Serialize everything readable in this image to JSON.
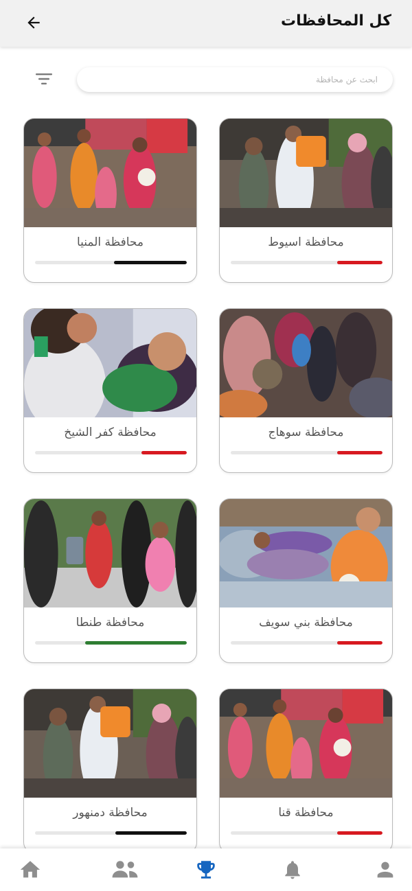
{
  "header": {
    "title": "كل المحافظات"
  },
  "search": {
    "placeholder": "ابحث عن محافظة",
    "value": ""
  },
  "governorates": [
    {
      "name": "محافظة اسيوط",
      "progress": 0.3,
      "color": "#d71920"
    },
    {
      "name": "محافظة المنيا",
      "progress": 0.48,
      "color": "#111111"
    },
    {
      "name": "محافظة سوهاج",
      "progress": 0.3,
      "color": "#d71920"
    },
    {
      "name": "محافظة كفر الشيخ",
      "progress": 0.3,
      "color": "#d71920"
    },
    {
      "name": "محافظة بني سويف",
      "progress": 0.3,
      "color": "#d71920"
    },
    {
      "name": "محافظة طنطا",
      "progress": 0.67,
      "color": "#2e7d32"
    },
    {
      "name": "محافظة قنا",
      "progress": 0.3,
      "color": "#d71920"
    },
    {
      "name": "محافظة دمنهور",
      "progress": 0.47,
      "color": "#111111"
    }
  ],
  "nav": {
    "items": [
      {
        "icon": "profile-icon",
        "active": false
      },
      {
        "icon": "bell-icon",
        "active": false
      },
      {
        "icon": "trophy-icon",
        "active": true
      },
      {
        "icon": "users-icon",
        "active": false
      },
      {
        "icon": "home-icon",
        "active": false
      }
    ],
    "active_color": "#1565c0",
    "inactive_color": "#8e8e8e"
  }
}
